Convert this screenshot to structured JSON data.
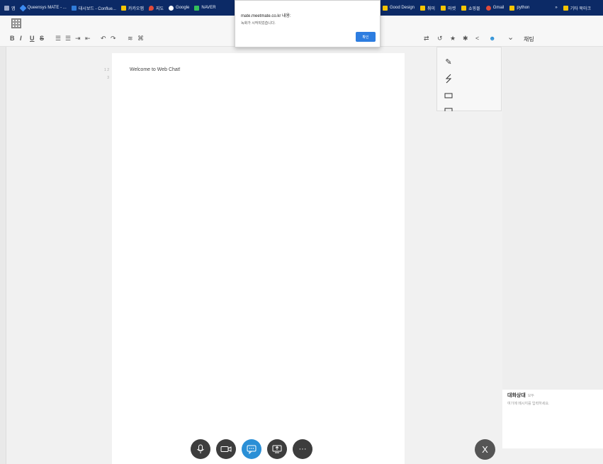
{
  "bookmarks": [
    {
      "label": "앱",
      "color": "#9aa7c7"
    },
    {
      "label": "Queensys MATE - ...",
      "color": "#3d8bf0"
    },
    {
      "label": "대시보드 - Conflue...",
      "color": "#2f7bd8"
    },
    {
      "label": "카카오맵",
      "color": "#f6c500"
    },
    {
      "label": "지도",
      "color": "#e04b3a"
    },
    {
      "label": "Google",
      "color": "#ffffff"
    },
    {
      "label": "NAVER",
      "color": "#33c15a"
    }
  ],
  "bookmarks_right": [
    {
      "label": "Good Design",
      "color": "#f6c500"
    },
    {
      "label": "취미",
      "color": "#f6c500"
    },
    {
      "label": "마켓",
      "color": "#f6c500"
    },
    {
      "label": "쇼핑몰",
      "color": "#f6c500"
    },
    {
      "label": "Gmail",
      "color": "#e04b3a"
    },
    {
      "label": "python",
      "color": "#f6c500"
    },
    {
      "label": "»",
      "color": ""
    },
    {
      "label": "기타 북마크",
      "color": "#f6c500"
    }
  ],
  "toolbar": {
    "bold": "B",
    "italic": "I",
    "underline": "U",
    "strike": "S",
    "list_ul": "☰",
    "list_ol": "☰",
    "indent": "⇥",
    "outdent": "⇤",
    "undo": "↶",
    "redo": "↷",
    "extra1": "≋",
    "extra2": "⌘"
  },
  "toolbar_right": {
    "swap": "⇄",
    "history": "↺",
    "star": "★",
    "settings": "✱",
    "share": "<",
    "people": "☻",
    "chevron": "⌄",
    "chat_tab": "채팅"
  },
  "document": {
    "text": "Welcome to Web Chat!",
    "line_numbers": "1 2 3"
  },
  "alert": {
    "title": "mate.meetmate.co.kr 내용:",
    "message": "녹화가 시작되었습니다.",
    "confirm": "확인"
  },
  "chat": {
    "heading": "대화상대",
    "heading_sub": "모두",
    "placeholder": "여기에 메시지를 입력하세요."
  },
  "controls": {
    "mic": "🎙",
    "camera": "▭",
    "chat": "💬",
    "screen": "▣",
    "more": "···",
    "close": "X"
  }
}
